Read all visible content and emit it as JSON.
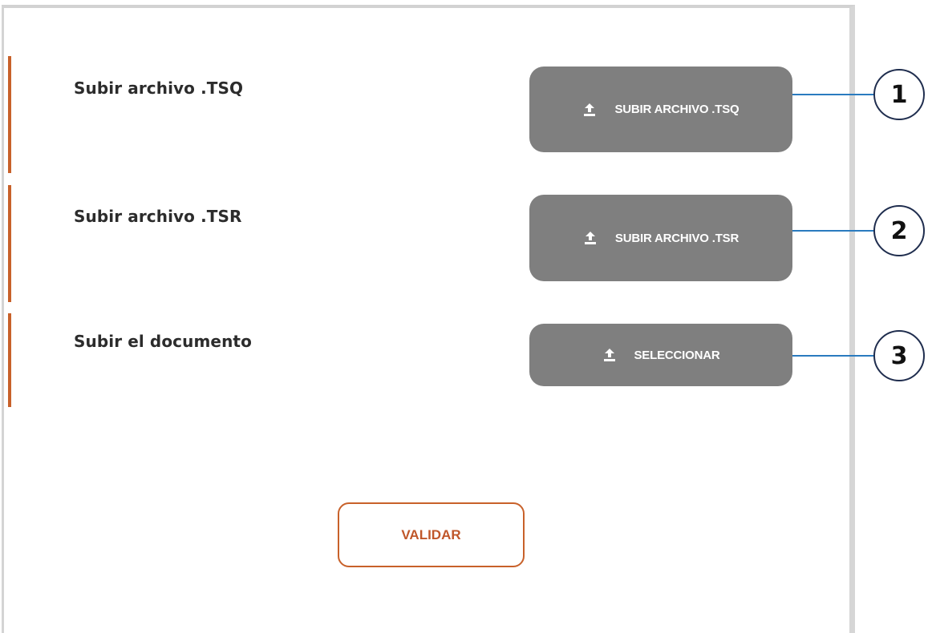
{
  "rows": [
    {
      "label": "Subir archivo .TSQ",
      "button_label": "SUBIR ARCHIVO .TSQ",
      "callout": "1",
      "icon": "upload-icon"
    },
    {
      "label": "Subir archivo .TSR",
      "button_label": "SUBIR ARCHIVO .TSR",
      "callout": "2",
      "icon": "upload-icon"
    },
    {
      "label": "Subir el documento",
      "button_label": "SELECCIONAR",
      "callout": "3",
      "icon": "upload-icon"
    }
  ],
  "validate_label": "VALIDAR",
  "colors": {
    "accent": "#c8612a",
    "button_gray": "#7f7f7f",
    "callout_line": "#2a7bbf",
    "callout_border": "#1f2d4e"
  }
}
